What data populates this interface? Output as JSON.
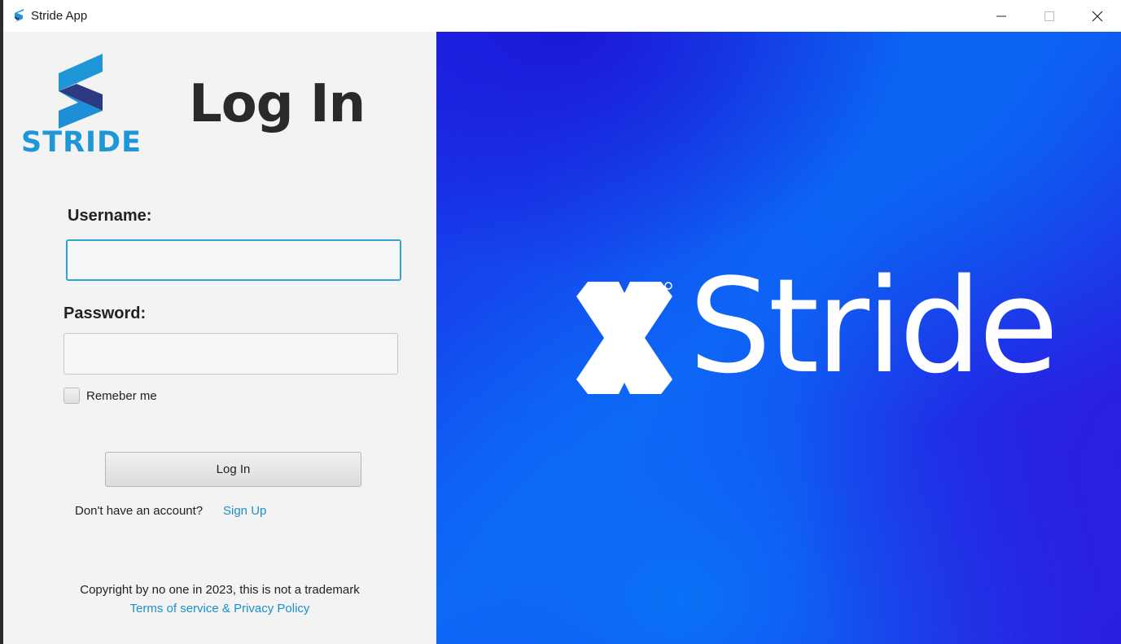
{
  "window": {
    "title": "Stride App",
    "app_icon": "stride-s-icon",
    "controls": [
      "minimize-icon",
      "maximize-icon",
      "close-icon"
    ]
  },
  "brand": {
    "logo_text": "STRIDE",
    "logo_color": "#1e96d8",
    "logo_dark_color": "#2c3a82"
  },
  "login": {
    "heading": "Log In",
    "username_label": "Username:",
    "username_value": "",
    "password_label": "Password:",
    "password_value": "",
    "remember_label": "Remeber me",
    "remember_checked": false,
    "submit_label": "Log In",
    "no_account_text": "Don't have an account?",
    "signup_link": "Sign Up"
  },
  "footer": {
    "copyright": "Copyright by no one in 2023, this is not a trademark",
    "terms_link": "Terms of service & Privacy Policy"
  },
  "hero": {
    "brand_text": "Stride",
    "mark_icon": "stride-x-logo-icon",
    "accent_color": "#0a66f2",
    "link_color": "#1e8fc9",
    "focus_color": "#2da3d6"
  }
}
